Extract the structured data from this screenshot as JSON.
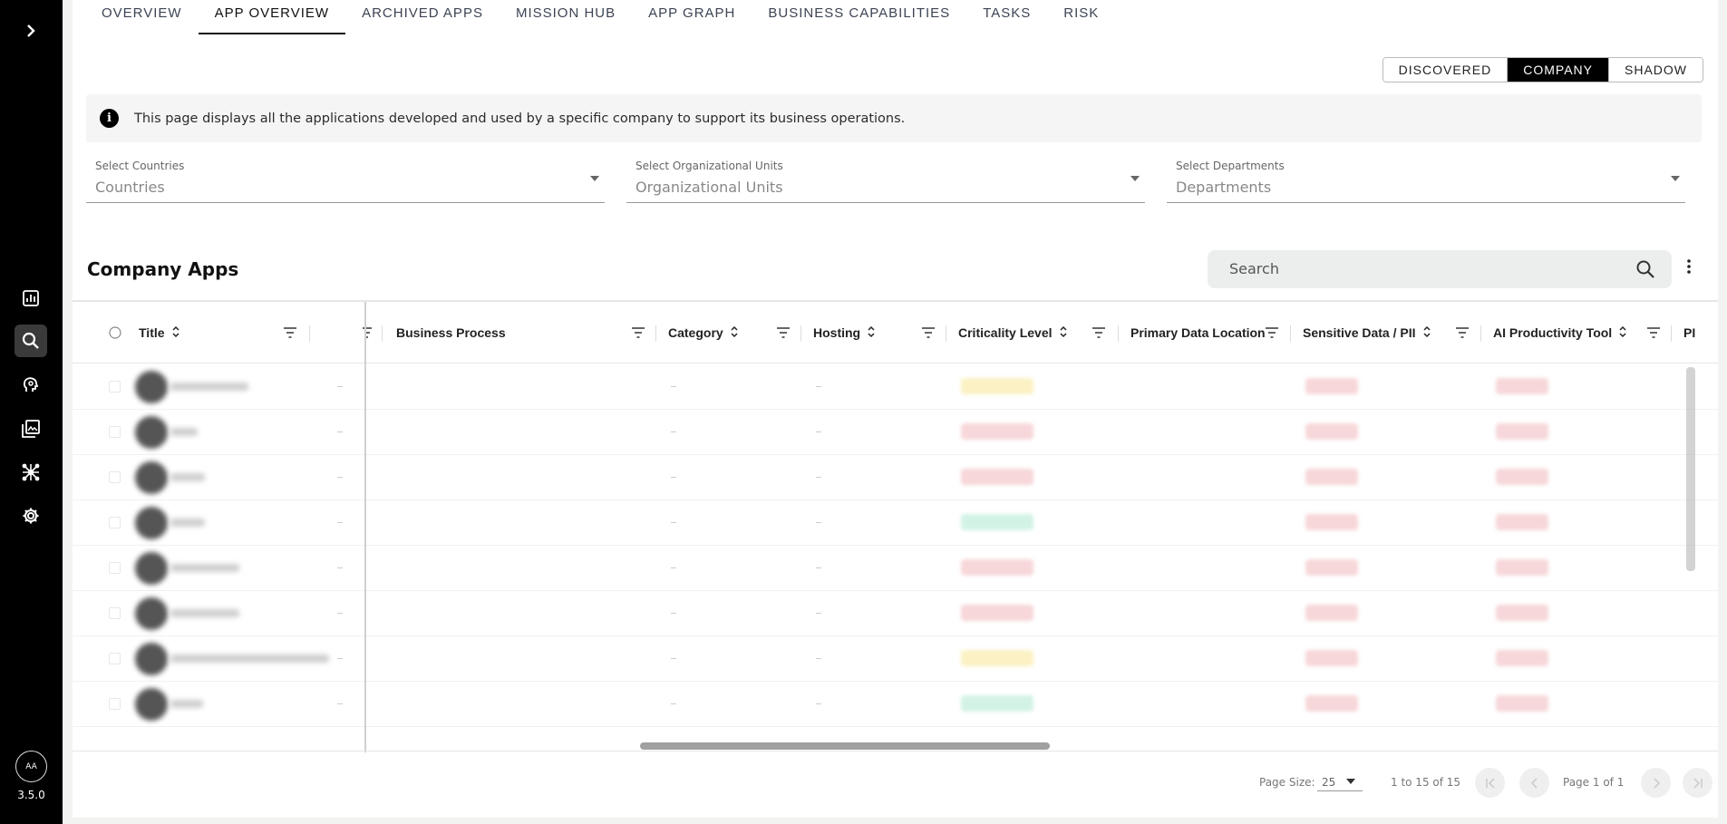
{
  "sidebar": {
    "version": "3.5.0",
    "avatar_initials": "AA",
    "items": [
      {
        "icon": "bar-chart-icon"
      },
      {
        "icon": "search-icon",
        "active": true
      },
      {
        "icon": "brain-icon"
      },
      {
        "icon": "gallery-icon"
      },
      {
        "icon": "network-icon"
      },
      {
        "icon": "gear-icon"
      }
    ]
  },
  "tabs": [
    "OVERVIEW",
    "APP OVERVIEW",
    "ARCHIVED APPS",
    "MISSION HUB",
    "APP GRAPH",
    "BUSINESS CAPABILITIES",
    "TASKS",
    "RISK"
  ],
  "active_tab": "APP OVERVIEW",
  "view_toggle": [
    "DISCOVERED",
    "COMPANY",
    "SHADOW"
  ],
  "active_view": "COMPANY",
  "info_text": "This page displays all the applications developed and used by a specific company to support its business operations.",
  "filters": [
    {
      "label": "Select Countries",
      "placeholder": "Countries"
    },
    {
      "label": "Select Organizational Units",
      "placeholder": "Organizational Units"
    },
    {
      "label": "Select Departments",
      "placeholder": "Departments"
    }
  ],
  "section_title": "Company Apps",
  "search_placeholder": "Search",
  "columns": [
    "Title",
    "Business Process",
    "Category",
    "Hosting",
    "Criticality Level",
    "Primary Data Location",
    "Sensitive Data / PII",
    "AI Productivity Tool",
    "PI"
  ],
  "rows": [
    {
      "criticality": "medium"
    },
    {
      "criticality": "high"
    },
    {
      "criticality": "high"
    },
    {
      "criticality": "low"
    },
    {
      "criticality": "high"
    },
    {
      "criticality": "high"
    },
    {
      "criticality": "medium"
    },
    {
      "criticality": "low"
    }
  ],
  "pagination": {
    "page_size_label": "Page Size:",
    "page_size": "25",
    "range": "1 to 15 of 15",
    "page": "Page 1 of 1"
  },
  "colors": {
    "high": "#f7d7d9",
    "medium": "#fbf1c4",
    "low": "#d3f2e6",
    "no": "#f7d7d9"
  }
}
